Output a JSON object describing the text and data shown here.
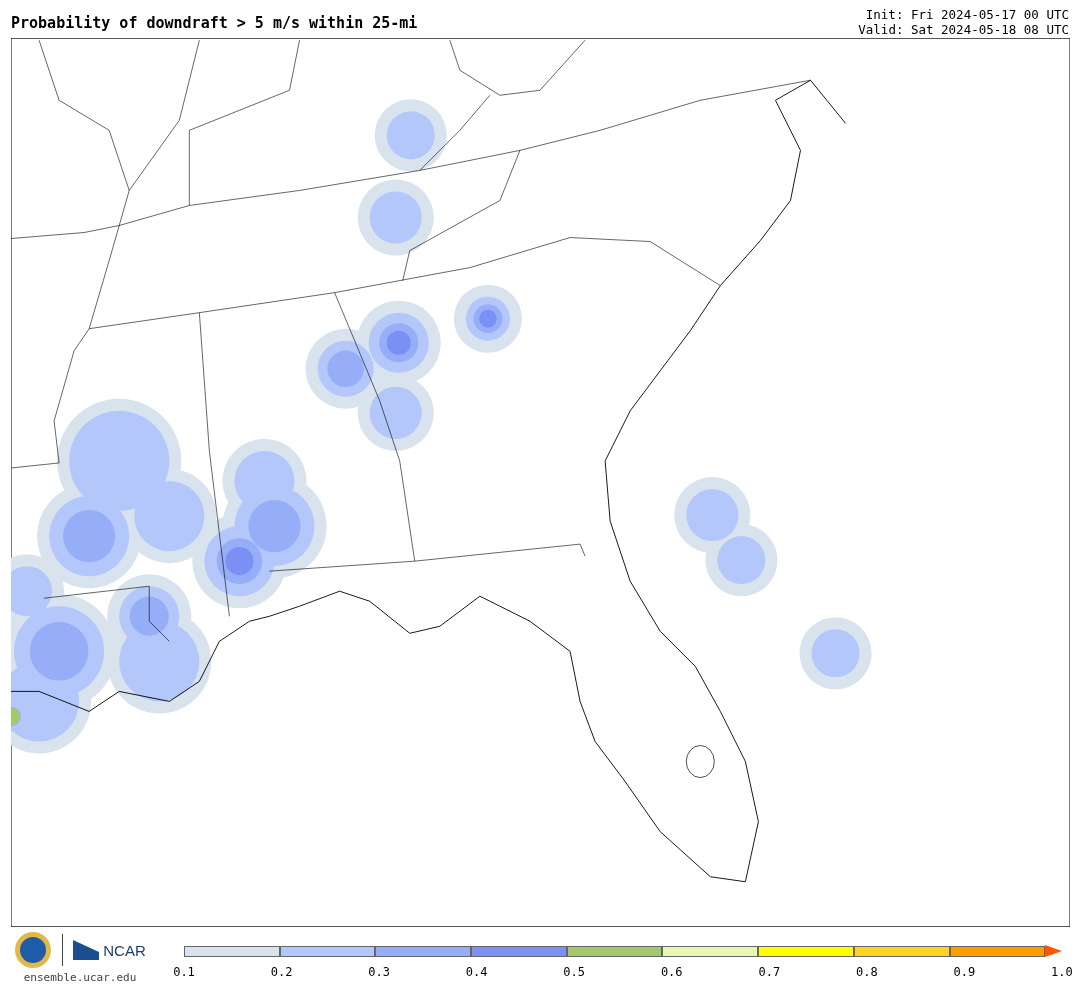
{
  "title": "Probability of downdraft > 5 m/s within 25-mi",
  "init": "Init: Fri 2024-05-17 00 UTC",
  "valid": "Valid: Sat 2024-05-18 08 UTC",
  "colorbar": {
    "segments": [
      {
        "color": "#d8e3ee"
      },
      {
        "color": "#b3c7fb"
      },
      {
        "color": "#96adf7"
      },
      {
        "color": "#7b90f4"
      },
      {
        "color": "#a4c96c"
      },
      {
        "color": "#e8f8b0"
      },
      {
        "color": "#ffff00"
      },
      {
        "color": "#ffd324"
      },
      {
        "color": "#ff9c00"
      }
    ],
    "overflow": {
      "color": "#ff5500"
    },
    "ticks": [
      "0.1",
      "0.2",
      "0.3",
      "0.4",
      "0.5",
      "0.6",
      "0.7",
      "0.8",
      "0.9",
      "1.0"
    ]
  },
  "footer": {
    "logo_text": "NCAR",
    "url": "ensemble.ucar.edu"
  }
}
